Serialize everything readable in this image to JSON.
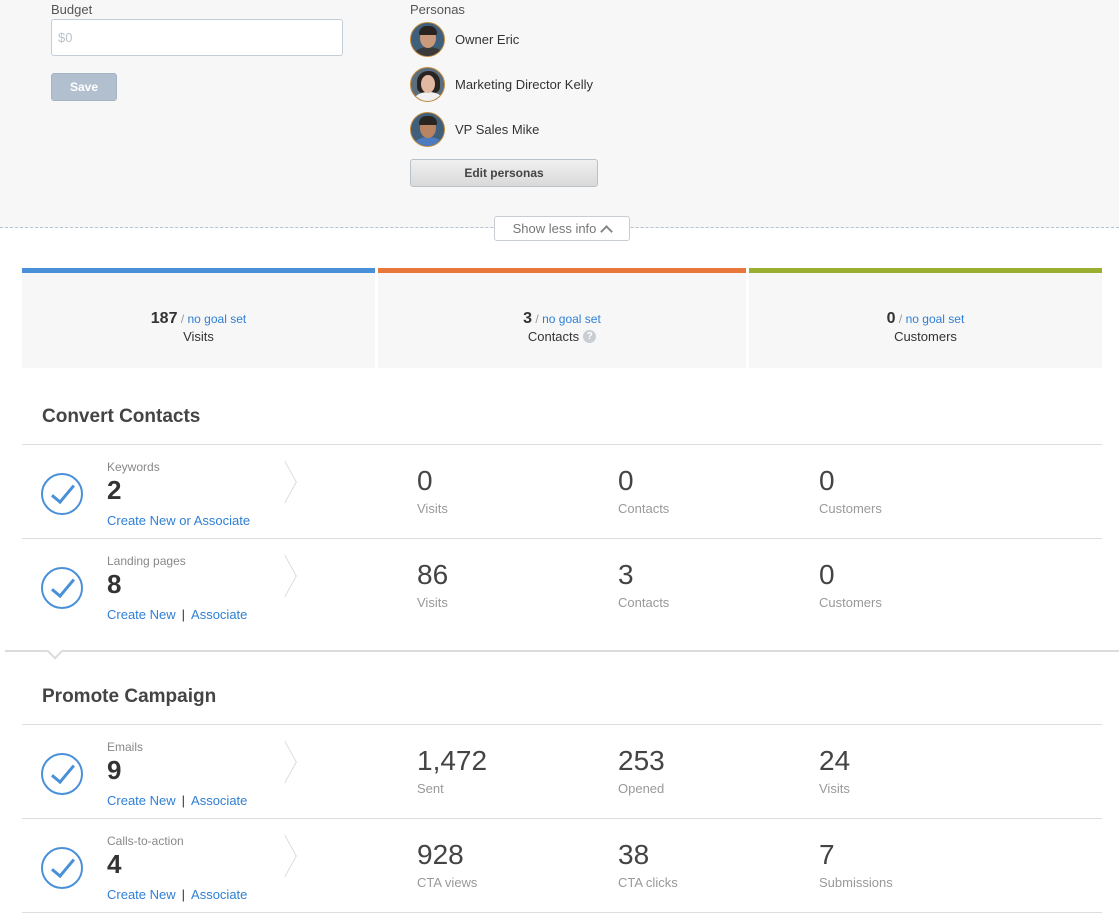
{
  "info": {
    "budget_label": "Budget",
    "budget_value": "",
    "budget_placeholder": "$0",
    "save_label": "Save",
    "personas_label": "Personas",
    "personas": [
      {
        "name": "Owner Eric"
      },
      {
        "name": "Marketing Director Kelly"
      },
      {
        "name": "VP Sales Mike"
      }
    ],
    "edit_personas_label": "Edit personas",
    "show_less_label": "Show less info"
  },
  "goals": [
    {
      "value": "187",
      "goal": "no goal set",
      "label": "Visits",
      "color": "#4a90d9"
    },
    {
      "value": "3",
      "goal": "no goal set",
      "label": "Contacts",
      "color": "#e8773c",
      "help": "?"
    },
    {
      "value": "0",
      "goal": "no goal set",
      "label": "Customers",
      "color": "#9aaf30"
    }
  ],
  "sections": [
    {
      "title": "Convert Contacts",
      "rows": [
        {
          "type": "Keywords",
          "count": "2",
          "links": [
            "Create New or Associate"
          ],
          "stats": [
            {
              "value": "0",
              "label": "Visits"
            },
            {
              "value": "0",
              "label": "Contacts"
            },
            {
              "value": "0",
              "label": "Customers"
            }
          ]
        },
        {
          "type": "Landing pages",
          "count": "8",
          "links": [
            "Create New",
            "Associate"
          ],
          "stats": [
            {
              "value": "86",
              "label": "Visits"
            },
            {
              "value": "3",
              "label": "Contacts"
            },
            {
              "value": "0",
              "label": "Customers"
            }
          ]
        }
      ]
    },
    {
      "title": "Promote Campaign",
      "rows": [
        {
          "type": "Emails",
          "count": "9",
          "links": [
            "Create New",
            "Associate"
          ],
          "stats": [
            {
              "value": "1,472",
              "label": "Sent"
            },
            {
              "value": "253",
              "label": "Opened"
            },
            {
              "value": "24",
              "label": "Visits"
            }
          ]
        },
        {
          "type": "Calls-to-action",
          "count": "4",
          "links": [
            "Create New",
            "Associate"
          ],
          "stats": [
            {
              "value": "928",
              "label": "CTA views"
            },
            {
              "value": "38",
              "label": "CTA clicks"
            },
            {
              "value": "7",
              "label": "Submissions"
            }
          ]
        }
      ]
    }
  ],
  "link_separator": "|"
}
